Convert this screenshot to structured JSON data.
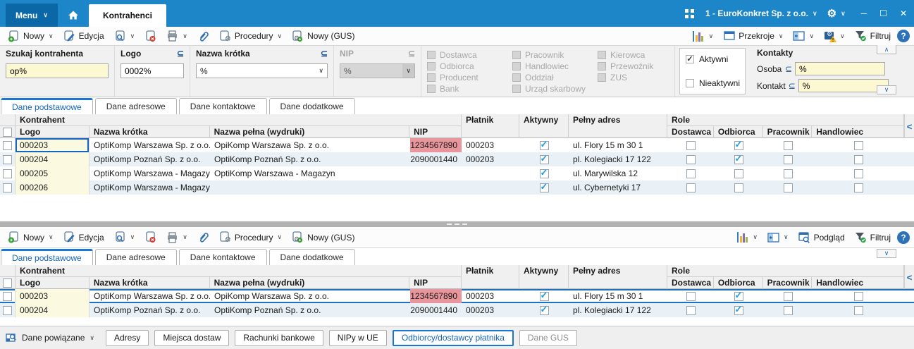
{
  "titlebar": {
    "menu": "Menu",
    "tab": "Kontrahenci",
    "company": "1 - EuroKonkret Sp. z o.o."
  },
  "toolbar": {
    "nowy": "Nowy",
    "edycja": "Edycja",
    "procedury": "Procedury",
    "nowy_gus": "Nowy (GUS)",
    "przekroje": "Przekroje",
    "filtruj": "Filtruj",
    "podglad": "Podgląd",
    "dane_powiazane": "Dane powiązane"
  },
  "filters": {
    "szukaj_label": "Szukaj kontrahenta",
    "szukaj_value": "op%",
    "logo_label": "Logo",
    "logo_value": "0002%",
    "nazwa_krotka_label": "Nazwa krótka",
    "nazwa_krotka_value": "%",
    "nip_label": "NIP",
    "nip_value": "%",
    "subset": "⊆",
    "role_col1": [
      "Dostawca",
      "Odbiorca",
      "Producent",
      "Bank"
    ],
    "role_col2": [
      "Pracownik",
      "Handlowiec",
      "Oddział",
      "Urząd skarbowy"
    ],
    "role_col3": [
      "Kierowca",
      "Przewoźnik",
      "ZUS"
    ],
    "aktywni_label": "Aktywni",
    "aktywni_checked": true,
    "nieaktywni_label": "Nieaktywni",
    "nieaktywni_checked": false,
    "kontakty_header": "Kontakty",
    "osoba_label": "Osoba",
    "osoba_value": "%",
    "kontakt_label": "Kontakt",
    "kontakt_value": "%"
  },
  "view_tabs": [
    "Dane podstawowe",
    "Dane adresowe",
    "Dane kontaktowe",
    "Dane dodatkowe"
  ],
  "grid_columns": {
    "group_kontrahent": "Kontrahent",
    "group_role": "Role",
    "logo": "Logo",
    "nazwa_krotka": "Nazwa krótka",
    "nazwa_pelna": "Nazwa pełna (wydruki)",
    "nip": "NIP",
    "platnik": "Płatnik",
    "aktywny": "Aktywny",
    "pelny_adres": "Pełny adres",
    "dostawca": "Dostawca",
    "odbiorca": "Odbiorca",
    "pracownik": "Pracownik",
    "handlowiec": "Handlowiec"
  },
  "grid1": {
    "rows": [
      {
        "logo": "000203",
        "nazwa_krotka": "OptiKomp Warszawa Sp. z o.o.",
        "nazwa_pelna": "OpiKomp Warszawa Sp. z o.o.",
        "nip": "1234567890",
        "nip_alert": true,
        "platnik": "000203",
        "aktywny": true,
        "adres": "ul. Flory 15 m 30 1",
        "dostawca": false,
        "odbiorca": true,
        "pracownik": false,
        "handlowiec": false,
        "focused": true
      },
      {
        "logo": "000204",
        "nazwa_krotka": "OptiKomp Poznań Sp. z o.o.",
        "nazwa_pelna": "OptiKomp Poznań Sp. z o.o.",
        "nip": "2090001440",
        "nip_alert": false,
        "platnik": "000203",
        "aktywny": true,
        "adres": "pl. Kolegiacki 17 122",
        "dostawca": false,
        "odbiorca": true,
        "pracownik": false,
        "handlowiec": false
      },
      {
        "logo": "000205",
        "nazwa_krotka": "OptiKomp Warszawa - Magazyn Ż",
        "nazwa_pelna": "OptiKomp Warszawa - Magazyn",
        "nip": "",
        "nip_alert": false,
        "platnik": "",
        "aktywny": true,
        "adres": "ul. Marywilska 12",
        "dostawca": false,
        "odbiorca": false,
        "pracownik": false,
        "handlowiec": false
      },
      {
        "logo": "000206",
        "nazwa_krotka": "OptiKomp Warszawa - Magazyn M",
        "nazwa_pelna": "",
        "nip": "",
        "nip_alert": false,
        "platnik": "",
        "aktywny": true,
        "adres": "ul. Cybernetyki 17",
        "dostawca": false,
        "odbiorca": false,
        "pracownik": false,
        "handlowiec": false
      }
    ]
  },
  "grid2": {
    "rows": [
      {
        "logo": "000203",
        "nazwa_krotka": "OptiKomp Warszawa Sp. z o.o.",
        "nazwa_pelna": "OpiKomp Warszawa Sp. z o.o.",
        "nip": "1234567890",
        "nip_alert": true,
        "platnik": "000203",
        "aktywny": true,
        "adres": "ul. Flory 15 m 30 1",
        "dostawca": false,
        "odbiorca": true,
        "pracownik": false,
        "handlowiec": false,
        "selected": true
      },
      {
        "logo": "000204",
        "nazwa_krotka": "OptiKomp Poznań Sp. z o.o.",
        "nazwa_pelna": "OptiKomp Poznań Sp. z o.o.",
        "nip": "2090001440",
        "nip_alert": false,
        "platnik": "000203",
        "aktywny": true,
        "adres": "pl. Kolegiacki 17 122",
        "dostawca": false,
        "odbiorca": true,
        "pracownik": false,
        "handlowiec": false
      }
    ]
  },
  "bottom_bar": {
    "tabs": [
      "Adresy",
      "Miejsca dostaw",
      "Rachunki bankowe",
      "NIPy w UE",
      "Odbiorcy/dostawcy płatnika",
      "Dane GUS"
    ],
    "active_tab": "Odbiorcy/dostawcy płatnika"
  },
  "colors": {
    "titlebar": "#1d86c8",
    "accent": "#1976d2",
    "row_alt": "#e9f1f6",
    "nip_alert_bg": "#e8959b",
    "filter_input_yellow": "#fcf8d2",
    "logo_column_bg": "#fbfae1"
  }
}
